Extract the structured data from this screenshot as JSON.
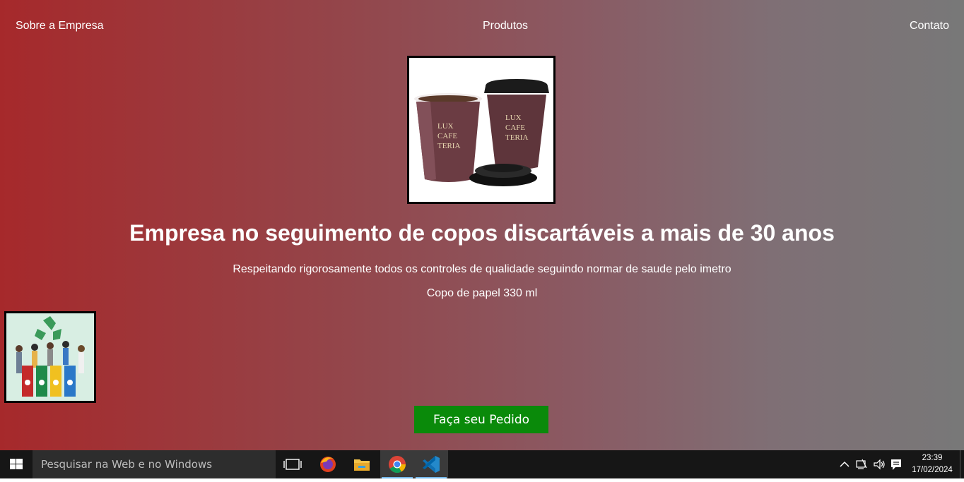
{
  "nav": {
    "sobre": "Sobre a Empresa",
    "produtos": "Produtos",
    "contato": "Contato"
  },
  "product_image": {
    "brand_text": [
      "LUX",
      "CAFE",
      "TERIA"
    ]
  },
  "hero": {
    "headline": "Empresa no seguimento de copos discartáveis a mais de 30 anos",
    "subtext": "Respeitando rigorosamente todos os controles de qualidade seguindo normar de saude pelo imetro",
    "product_name": "Copo de papel 330 ml"
  },
  "order_button": "Faça seu Pedido",
  "taskbar": {
    "search_placeholder": "Pesquisar na Web e no Windows",
    "time": "23:39",
    "date": "17/02/2024",
    "apps": [
      "task-view",
      "firefox",
      "file-explorer",
      "chrome",
      "vscode"
    ],
    "active_app": "chrome"
  },
  "colors": {
    "gradient_left": "#a6292b",
    "gradient_right": "#787878",
    "button_green": "#0a8a0a",
    "taskbar": "#161616"
  }
}
